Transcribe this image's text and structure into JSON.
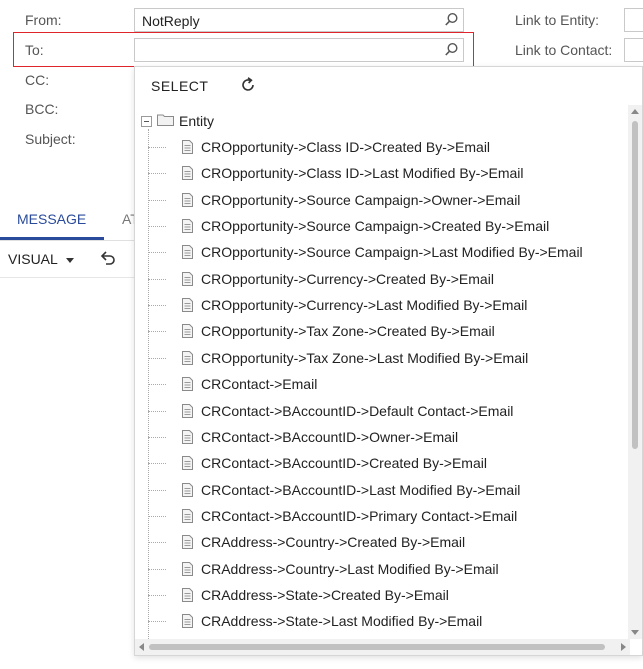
{
  "form": {
    "from_label": "From:",
    "from_value": "NotReply",
    "to_label": "To:",
    "to_value": "",
    "cc_label": "CC:",
    "bcc_label": "BCC:",
    "subject_label": "Subject:",
    "link_entity_label": "Link to Entity:",
    "link_contact_label": "Link to Contact:"
  },
  "tabs": {
    "message": "MESSAGE",
    "attachments_partial": "AT"
  },
  "editor": {
    "visual_label": "VISUAL"
  },
  "dropdown": {
    "select_label": "SELECT",
    "root_label": "Entity",
    "items": [
      "CROpportunity->Class ID->Created By->Email",
      "CROpportunity->Class ID->Last Modified By->Email",
      "CROpportunity->Source Campaign->Owner->Email",
      "CROpportunity->Source Campaign->Created By->Email",
      "CROpportunity->Source Campaign->Last Modified By->Email",
      "CROpportunity->Currency->Created By->Email",
      "CROpportunity->Currency->Last Modified By->Email",
      "CROpportunity->Tax Zone->Created By->Email",
      "CROpportunity->Tax Zone->Last Modified By->Email",
      "CRContact->Email",
      "CRContact->BAccountID->Default Contact->Email",
      "CRContact->BAccountID->Owner->Email",
      "CRContact->BAccountID->Created By->Email",
      "CRContact->BAccountID->Last Modified By->Email",
      "CRContact->BAccountID->Primary Contact->Email",
      "CRAddress->Country->Created By->Email",
      "CRAddress->Country->Last Modified By->Email",
      "CRAddress->State->Created By->Email",
      "CRAddress->State->Last Modified By->Email"
    ]
  },
  "colors": {
    "accent": "#2a4b9b",
    "highlight_border": "#e0242b"
  }
}
